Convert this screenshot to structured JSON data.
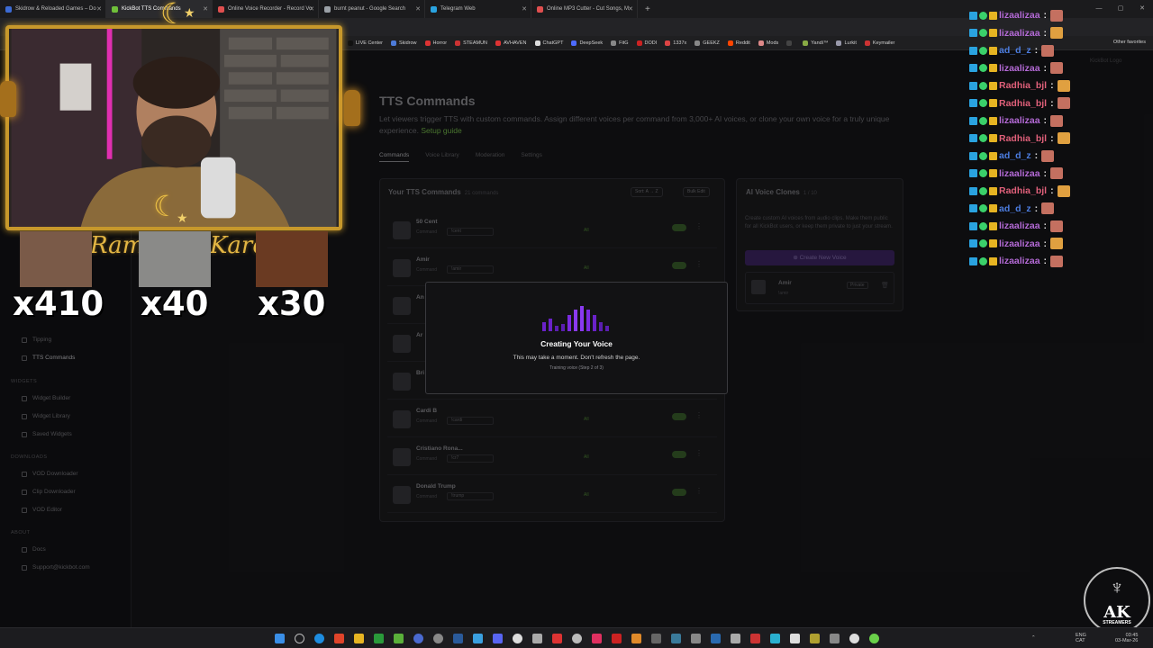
{
  "browser": {
    "tabs": [
      {
        "label": "Skidrow & Reloaded Games – Do",
        "color": "#3c6bd4"
      },
      {
        "label": "KickBot TTS Commands",
        "color": "#6fbf3a",
        "active": true
      },
      {
        "label": "Online Voice Recorder - Record Vo",
        "color": "#e04f4f"
      },
      {
        "label": "burnt peanut - Google Search",
        "color": "#9aa0a6"
      },
      {
        "label": "Telegram Web",
        "color": "#2aa3e0"
      },
      {
        "label": "Online MP3 Cutter - Cut Songs, M",
        "color": "#e04f4f"
      }
    ],
    "bookmarks": [
      {
        "label": "LIVE Center",
        "color": "#111111"
      },
      {
        "label": "Skidrow",
        "color": "#4d7bd8"
      },
      {
        "label": "Horror",
        "color": "#d33"
      },
      {
        "label": "STEAMUN",
        "color": "#c33"
      },
      {
        "label": "AVHAVEN",
        "color": "#d33"
      },
      {
        "label": "ChatGPT",
        "color": "#ddd"
      },
      {
        "label": "DeepSeek",
        "color": "#4d6bfe"
      },
      {
        "label": "FitG",
        "color": "#888"
      },
      {
        "label": "DODI",
        "color": "#c22"
      },
      {
        "label": "1337x",
        "color": "#d44"
      },
      {
        "label": "GEEKZ",
        "color": "#888"
      },
      {
        "label": "Reddit",
        "color": "#ff4500"
      },
      {
        "label": "Mods",
        "color": "#d88"
      },
      {
        "label": "",
        "color": "#444"
      },
      {
        "label": "Yandi™",
        "color": "#8a4"
      },
      {
        "label": "Lurkit",
        "color": "#99a"
      },
      {
        "label": "Keymailer",
        "color": "#c33"
      }
    ],
    "other_favorites": "Other favorites"
  },
  "sidebar": {
    "sections": [
      {
        "label": "WIDGETS",
        "items": [
          "Widget Builder",
          "Widget Library",
          "Saved Widgets"
        ]
      },
      {
        "label": "DOWNLOADS",
        "items": [
          "VOD Downloader",
          "Clip Downloader",
          "VOD Editor"
        ]
      },
      {
        "label": "ABOUT",
        "items": [
          "Docs",
          "Support@kickbot.com"
        ]
      }
    ],
    "top_items": [
      "Tipping",
      "TTS Commands"
    ]
  },
  "main": {
    "logo": "KickBot Logo",
    "title": "TTS Commands",
    "desc": "Let viewers trigger TTS with custom commands. Assign different voices per command from 3,000+ AI voices, or clone your own voice for a truly unique experience.",
    "setup_link": "Setup guide",
    "tabs": [
      "Commands",
      "Voice Library",
      "Moderation",
      "Settings"
    ],
    "commands_title": "Your TTS Commands",
    "commands_count": "21 commands",
    "sort_label": "Sort: A → Z",
    "bulk_label": "Bulk Edit",
    "rows": [
      {
        "name": "50 Cent",
        "cmd": "!cent"
      },
      {
        "name": "Amir",
        "cmd": "!amir"
      },
      {
        "name": "An",
        "cmd": ""
      },
      {
        "name": "Ar",
        "cmd": ""
      },
      {
        "name": "Bri",
        "cmd": ""
      },
      {
        "name": "Cardi B",
        "cmd": "!cardi"
      },
      {
        "name": "Cristiano Rona...",
        "cmd": "!cr7"
      },
      {
        "name": "Donald Trump",
        "cmd": "!trump"
      }
    ],
    "row_all": "All",
    "row_command_label": "Command",
    "clones_title": "AI Voice Clones",
    "clones_count": "1 / 10",
    "clones_desc": "Create custom AI voices from audio clips. Make them public for all KickBot users, or keep them private to just your stream.",
    "create_clone_btn": "Create New Voice",
    "clone_item": {
      "name": "Amir",
      "cmd": "!amir",
      "badge": "Private"
    }
  },
  "modal": {
    "title": "Creating Your Voice",
    "subtitle": "This may take a moment. Don't refresh the page.",
    "step": "Training voice (Step 2 of 3)",
    "accent": "#7a2ae0"
  },
  "overlay": {
    "ramadan_text": "Ramadan Kareem",
    "counters": [
      {
        "value": "x410"
      },
      {
        "value": "x40"
      },
      {
        "value": "x30"
      }
    ]
  },
  "chat": [
    {
      "user": "lizaalizaa",
      "color": "#b46ad6"
    },
    {
      "user": "lizaalizaa",
      "color": "#b46ad6"
    },
    {
      "user": "ad_d_z",
      "color": "#4c7de0"
    },
    {
      "user": "lizaalizaa",
      "color": "#b46ad6"
    },
    {
      "user": "Radhia_bjl",
      "color": "#e0607a"
    },
    {
      "user": "Radhia_bjl",
      "color": "#e0607a"
    },
    {
      "user": "lizaalizaa",
      "color": "#b46ad6"
    },
    {
      "user": "Radhia_bjl",
      "color": "#e0607a"
    },
    {
      "user": "ad_d_z",
      "color": "#4c7de0"
    },
    {
      "user": "lizaalizaa",
      "color": "#b46ad6"
    },
    {
      "user": "Radhia_bjl",
      "color": "#e0607a"
    },
    {
      "user": "ad_d_z",
      "color": "#4c7de0"
    },
    {
      "user": "lizaalizaa",
      "color": "#b46ad6"
    },
    {
      "user": "lizaalizaa",
      "color": "#b46ad6"
    },
    {
      "user": "lizaalizaa",
      "color": "#b46ad6"
    }
  ],
  "watermark": {
    "big": "AK",
    "small": "STREAMERS"
  },
  "taskbar": {
    "lang": "ENG",
    "region": "CAT",
    "time": "03:45",
    "date": "03-Mar-26"
  }
}
